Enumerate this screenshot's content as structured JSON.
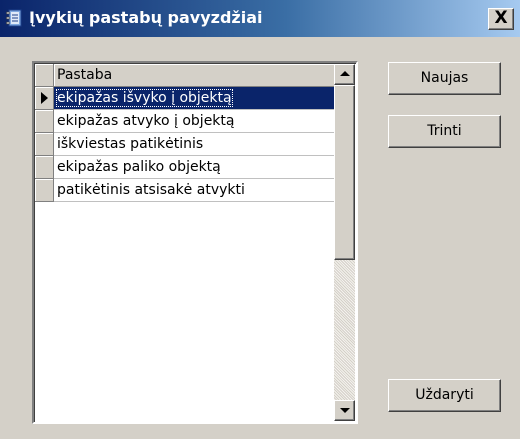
{
  "window": {
    "title": "Įvykių pastabų pavyzdžiai",
    "close_label": "X"
  },
  "grid": {
    "column_header": "Pastaba",
    "rows": [
      {
        "text": "ekipažas išvyko į objektą",
        "selected": true
      },
      {
        "text": "ekipažas atvyko į objektą",
        "selected": false
      },
      {
        "text": "iškviestas patikėtinis",
        "selected": false
      },
      {
        "text": "ekipažas paliko objektą",
        "selected": false
      },
      {
        "text": "patikėtinis atsisakė atvykti",
        "selected": false
      }
    ]
  },
  "buttons": {
    "new_label": "Naujas",
    "delete_label": "Trinti",
    "close_label": "Uždaryti"
  },
  "colors": {
    "selection": "#0a246a",
    "face": "#d4d0c8"
  }
}
